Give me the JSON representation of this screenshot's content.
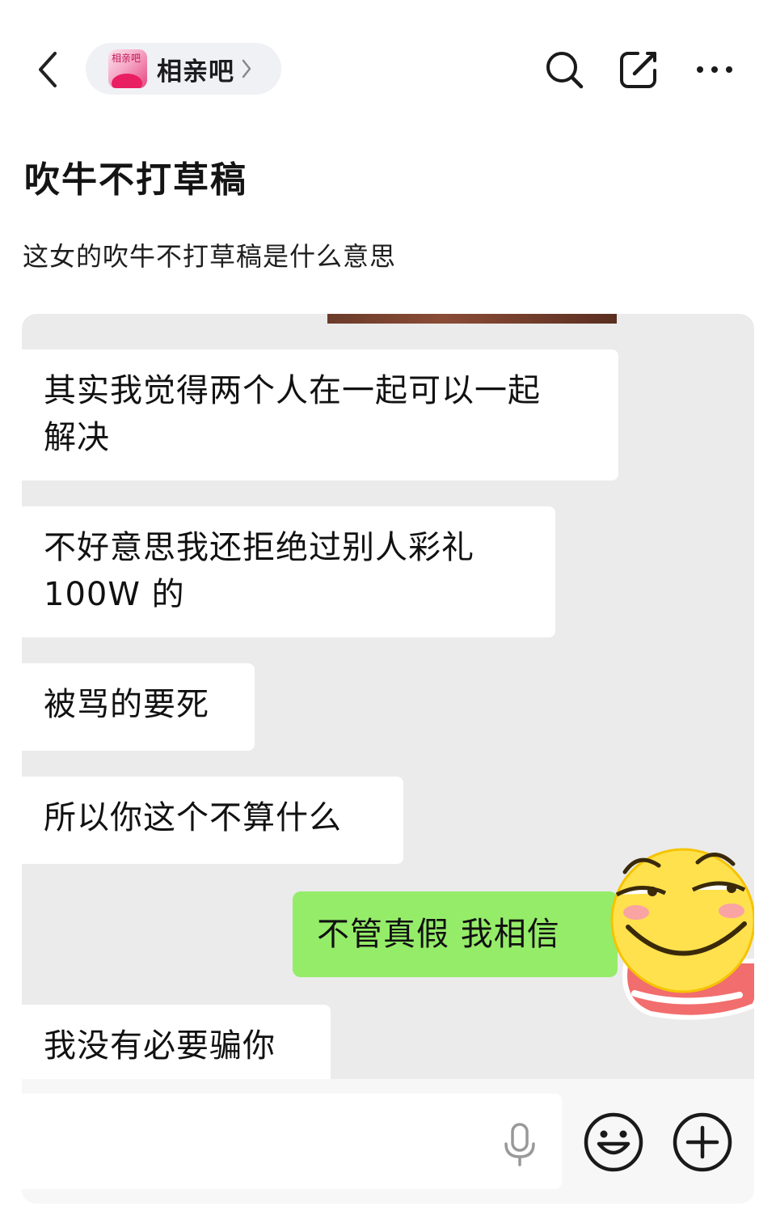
{
  "header": {
    "forum_name": "相亲吧",
    "forum_avatar_text": "相亲吧"
  },
  "post": {
    "title": "吹牛不打草稿",
    "body": "这女的吹牛不打草稿是什么意思"
  },
  "chat": {
    "messages": [
      {
        "side": "left",
        "line1": "其实我觉得两个人在一起可以一起",
        "line2": "解决"
      },
      {
        "side": "left",
        "line1": "不好意思我还拒绝过别人彩礼",
        "line2": "100W 的"
      },
      {
        "side": "left",
        "line1": "被骂的要死"
      },
      {
        "side": "left",
        "line1": "所以你这个不算什么"
      },
      {
        "side": "right",
        "line1": "不管真假 我相信"
      },
      {
        "side": "left",
        "line1": "我没有必要骗你"
      }
    ]
  },
  "colors": {
    "sent_bubble": "#95ec69",
    "received_bubble": "#ffffff",
    "chat_background": "#ebebeb",
    "pill_background": "#f0f1f5"
  },
  "icons": [
    "back-arrow-icon",
    "chevron-right-icon",
    "search-icon",
    "edit-icon",
    "more-icon",
    "microphone-icon",
    "smiley-icon",
    "plus-icon",
    "smirk-emoji-sticker"
  ]
}
